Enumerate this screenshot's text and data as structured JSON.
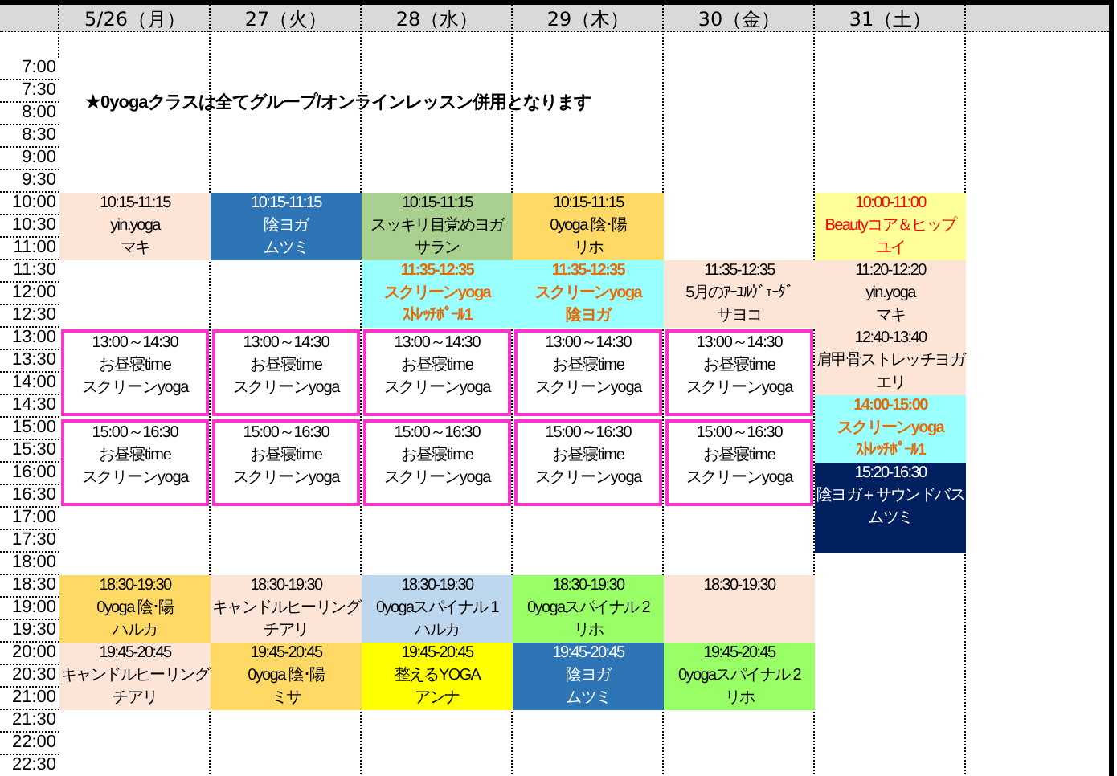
{
  "header": {
    "days": [
      "5/26（月）",
      "27（火）",
      "28（水）",
      "29（木）",
      "30（金）",
      "31（土）"
    ]
  },
  "notice": "★0yogaクラスは全てグループ/オンラインレッスン併用となります",
  "times": [
    "7:00",
    "7:30",
    "8:00",
    "8:30",
    "9:00",
    "9:30",
    "10:00",
    "10:30",
    "11:00",
    "11:30",
    "12:00",
    "12:30",
    "13:00",
    "13:30",
    "14:00",
    "14:30",
    "15:00",
    "15:30",
    "16:00",
    "16:30",
    "17:00",
    "17:30",
    "18:00",
    "18:30",
    "19:00",
    "19:30",
    "20:00",
    "20:30",
    "21:00",
    "21:30",
    "22:00",
    "22:30"
  ],
  "columns": [
    {
      "blocks": [
        {
          "kind": "empty"
        },
        {
          "kind": "empty"
        },
        {
          "kind": "empty"
        },
        {
          "kind": "empty"
        },
        {
          "kind": "empty"
        },
        {
          "kind": "empty"
        },
        {
          "kind": "class",
          "color": "#fce4d6",
          "lines": [
            "10:15-11:15",
            "yin.yoga",
            "マキ"
          ]
        },
        {
          "kind": "empty"
        },
        {
          "kind": "empty"
        },
        {
          "kind": "empty"
        },
        {
          "kind": "lunch",
          "lines": [
            "13:00～14:30",
            "お昼寝time",
            "スクリーンyoga"
          ]
        },
        {
          "kind": "lunch",
          "lines": [
            "15:00～16:30",
            "お昼寝time",
            "スクリーンyoga"
          ]
        },
        {
          "kind": "empty"
        },
        {
          "kind": "empty"
        },
        {
          "kind": "empty"
        },
        {
          "kind": "class",
          "color": "#ffd966",
          "lines": [
            "18:30-19:30",
            "0yoga  陰･陽",
            "ハルカ"
          ]
        },
        {
          "kind": "class",
          "color": "#fce4d6",
          "lines": [
            "19:45-20:45",
            "キャンドルヒーリング",
            "チアリ"
          ]
        }
      ]
    },
    {
      "blocks": [
        {
          "kind": "empty"
        },
        {
          "kind": "empty"
        },
        {
          "kind": "empty"
        },
        {
          "kind": "empty"
        },
        {
          "kind": "empty"
        },
        {
          "kind": "empty"
        },
        {
          "kind": "dark",
          "color": "#2e75b6",
          "lines": [
            "10:15-11:15",
            "陰ヨガ",
            "ムツミ"
          ]
        },
        {
          "kind": "empty"
        },
        {
          "kind": "empty"
        },
        {
          "kind": "empty"
        },
        {
          "kind": "lunch",
          "lines": [
            "13:00～14:30",
            "お昼寝time",
            "スクリーンyoga"
          ]
        },
        {
          "kind": "lunch",
          "lines": [
            "15:00～16:30",
            "お昼寝time",
            "スクリーンyoga"
          ]
        },
        {
          "kind": "empty"
        },
        {
          "kind": "empty"
        },
        {
          "kind": "empty"
        },
        {
          "kind": "class",
          "color": "#fce4d6",
          "lines": [
            "18:30-19:30",
            "キャンドルヒーリング",
            "チアリ"
          ]
        },
        {
          "kind": "class",
          "color": "#ffd966",
          "lines": [
            "19:45-20:45",
            "0yoga  陰･陽",
            "ミサ"
          ]
        }
      ]
    },
    {
      "blocks": [
        {
          "kind": "empty"
        },
        {
          "kind": "empty"
        },
        {
          "kind": "empty"
        },
        {
          "kind": "empty"
        },
        {
          "kind": "empty"
        },
        {
          "kind": "empty"
        },
        {
          "kind": "class",
          "color": "#a9d08e",
          "lines": [
            "10:15-11:15",
            "スッキリ目覚めヨガ",
            "サラン"
          ]
        },
        {
          "kind": "screen",
          "color": "#99ffff",
          "lines": [
            "11:35-12:35",
            "スクリーンyoga",
            "ｽﾄﾚｯﾁﾎﾟｰﾙ1"
          ]
        },
        {
          "kind": "lunch",
          "lines": [
            "13:00～14:30",
            "お昼寝time",
            "スクリーンyoga"
          ]
        },
        {
          "kind": "lunch",
          "lines": [
            "15:00～16:30",
            "お昼寝time",
            "スクリーンyoga"
          ]
        },
        {
          "kind": "empty"
        },
        {
          "kind": "empty"
        },
        {
          "kind": "empty"
        },
        {
          "kind": "class",
          "color": "#bdd7ee",
          "lines": [
            "18:30-19:30",
            "0yogaスパイナル  1",
            "ハルカ"
          ]
        },
        {
          "kind": "class",
          "color": "#ffff00",
          "lines": [
            "19:45-20:45",
            "整えるYOGA",
            "アンナ"
          ]
        }
      ]
    },
    {
      "blocks": [
        {
          "kind": "empty"
        },
        {
          "kind": "empty"
        },
        {
          "kind": "empty"
        },
        {
          "kind": "empty"
        },
        {
          "kind": "empty"
        },
        {
          "kind": "empty"
        },
        {
          "kind": "class",
          "color": "#ffd966",
          "lines": [
            "10:15-11:15",
            "0yoga  陰･陽",
            "リホ"
          ]
        },
        {
          "kind": "screen",
          "color": "#99ffff",
          "lines": [
            "11:35-12:35",
            "スクリーンyoga",
            "陰ヨガ"
          ]
        },
        {
          "kind": "lunch",
          "lines": [
            "13:00～14:30",
            "お昼寝time",
            "スクリーンyoga"
          ]
        },
        {
          "kind": "lunch",
          "lines": [
            "15:00～16:30",
            "お昼寝time",
            "スクリーンyoga"
          ]
        },
        {
          "kind": "empty"
        },
        {
          "kind": "empty"
        },
        {
          "kind": "empty"
        },
        {
          "kind": "class",
          "color": "#99ff66",
          "lines": [
            "18:30-19:30",
            "0yogaスパイナル  2",
            "リホ"
          ]
        },
        {
          "kind": "dark",
          "color": "#2e75b6",
          "lines": [
            "19:45-20:45",
            "陰ヨガ",
            "ムツミ"
          ]
        }
      ]
    },
    {
      "blocks": [
        {
          "kind": "empty"
        },
        {
          "kind": "empty"
        },
        {
          "kind": "empty"
        },
        {
          "kind": "empty"
        },
        {
          "kind": "empty"
        },
        {
          "kind": "empty"
        },
        {
          "kind": "empty"
        },
        {
          "kind": "empty"
        },
        {
          "kind": "empty"
        },
        {
          "kind": "class",
          "color": "#fce4d6",
          "lines": [
            "11:35-12:35",
            "5月のｱｰﾕﾙｳﾞｪｰﾀﾞ",
            "サヨコ"
          ]
        },
        {
          "kind": "lunch",
          "lines": [
            "13:00～14:30",
            "お昼寝time",
            "スクリーンyoga"
          ]
        },
        {
          "kind": "lunch",
          "lines": [
            "15:00～16:30",
            "お昼寝time",
            "スクリーンyoga"
          ]
        },
        {
          "kind": "empty"
        },
        {
          "kind": "empty"
        },
        {
          "kind": "empty"
        },
        {
          "kind": "class",
          "color": "#fce4d6",
          "lines": [
            "18:30-19:30"
          ]
        },
        {
          "kind": "class",
          "color": "#99ff66",
          "lines": [
            "19:45-20:45",
            "0yogaスパイナル  2",
            "リホ"
          ]
        }
      ]
    },
    {
      "blocks": [
        {
          "kind": "empty"
        },
        {
          "kind": "empty"
        },
        {
          "kind": "empty"
        },
        {
          "kind": "empty"
        },
        {
          "kind": "empty"
        },
        {
          "kind": "empty"
        },
        {
          "kind": "accent",
          "color": "#ffff99",
          "lines": [
            "10:00-11:00",
            "Beautyコア＆ヒップ",
            "ユイ"
          ]
        },
        {
          "kind": "class",
          "color": "#fce4d6",
          "lines": [
            "11:20-12:20",
            "yin.yoga",
            "マキ"
          ]
        },
        {
          "kind": "class",
          "color": "#fce4d6",
          "lines": [
            "12:40-13:40",
            "肩甲骨ストレッチヨガ",
            "エリ"
          ]
        },
        {
          "kind": "screen",
          "color": "#99ffff",
          "lines": [
            "14:00-15:00",
            "スクリーンyoga",
            "ｽﾄﾚｯﾁﾎﾟｰﾙ1"
          ]
        },
        {
          "kind": "dark",
          "color": "#002060",
          "lines": [
            "15:20-16:30",
            "陰ヨガ＋サウンドバス",
            "ムツミ"
          ]
        },
        {
          "kind": "continued"
        }
      ]
    }
  ]
}
